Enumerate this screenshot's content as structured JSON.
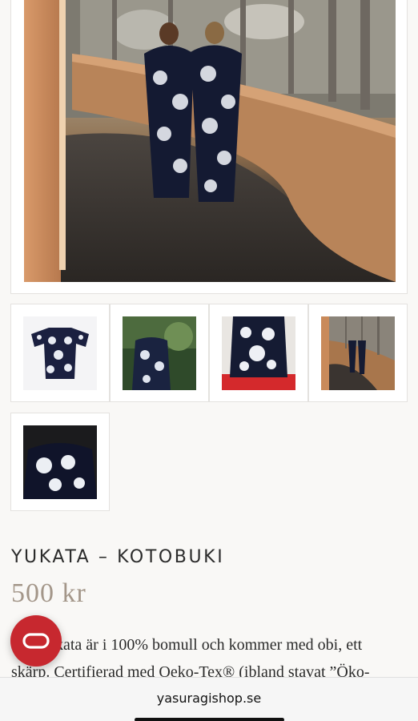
{
  "product": {
    "title": "YUKATA – KOTOBUKI",
    "price": "500 kr",
    "description_lines": [
      "Vår yukata är i 100% bomull och kommer med obi, ett",
      "skärp. Certifierad med Oeko-Tex® (ibland stavat ”Öko-"
    ]
  },
  "gallery": {
    "main_image": "two-women-in-yukata-walkway",
    "thumbnails": [
      "yukata-flat-lay",
      "yukata-back-garden",
      "yukata-seated-back",
      "yukata-walkway",
      "yukata-closeup-dark"
    ]
  },
  "chat": {
    "icon": "chat-loop-icon",
    "color": "#c7282f"
  },
  "browser": {
    "url": "yasuragishop.se"
  },
  "colors": {
    "price": "#a39689",
    "accent": "#c7282f",
    "background": "#f9f8f6"
  }
}
